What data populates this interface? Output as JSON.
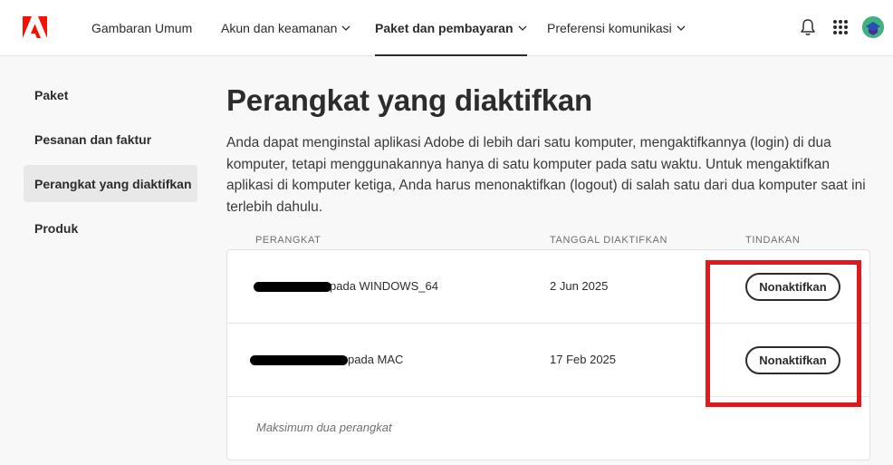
{
  "header": {
    "logo_icon": "adobe-logo",
    "nav_items": [
      {
        "label": "Gambaran Umum",
        "has_dropdown": false,
        "active": false
      },
      {
        "label": "Akun dan keamanan",
        "has_dropdown": true,
        "active": false
      },
      {
        "label": "Paket dan pembayaran",
        "has_dropdown": true,
        "active": true
      },
      {
        "label": "Preferensi komunikasi",
        "has_dropdown": true,
        "active": false
      }
    ],
    "icons": [
      "bell-icon",
      "app-grid-icon",
      "user-avatar"
    ]
  },
  "sidebar": {
    "items": [
      {
        "label": "Paket",
        "active": false
      },
      {
        "label": "Pesanan dan faktur",
        "active": false
      },
      {
        "label": "Perangkat yang diaktifkan",
        "active": true
      },
      {
        "label": "Produk",
        "active": false
      }
    ]
  },
  "main": {
    "title": "Perangkat yang diaktifkan",
    "description": "Anda dapat menginstal aplikasi Adobe di lebih dari satu komputer, mengaktifkannya (login) di dua komputer, tetapi menggunakannya hanya di satu komputer pada satu waktu. Untuk mengaktifkan aplikasi di komputer ketiga, Anda harus menonaktifkan (logout) di salah satu dari dua komputer saat ini terlebih dahulu.",
    "table": {
      "columns": [
        "PERANGKAT",
        "TANGGAL DIAKTIFKAN",
        "TINDAKAN"
      ],
      "rows": [
        {
          "device": "pada WINDOWS_64",
          "date": "2 Jun 2025",
          "action": "Nonaktifkan"
        },
        {
          "device": "pada MAC",
          "date": "17 Feb 2025",
          "action": "Nonaktifkan"
        }
      ],
      "footnote": "Maksimum dua perangkat"
    }
  },
  "colors": {
    "adobe_red": "#fa0f00",
    "highlight_red": "#e0191b",
    "text": "#2c2c2c",
    "background": "#f8f8f8"
  }
}
